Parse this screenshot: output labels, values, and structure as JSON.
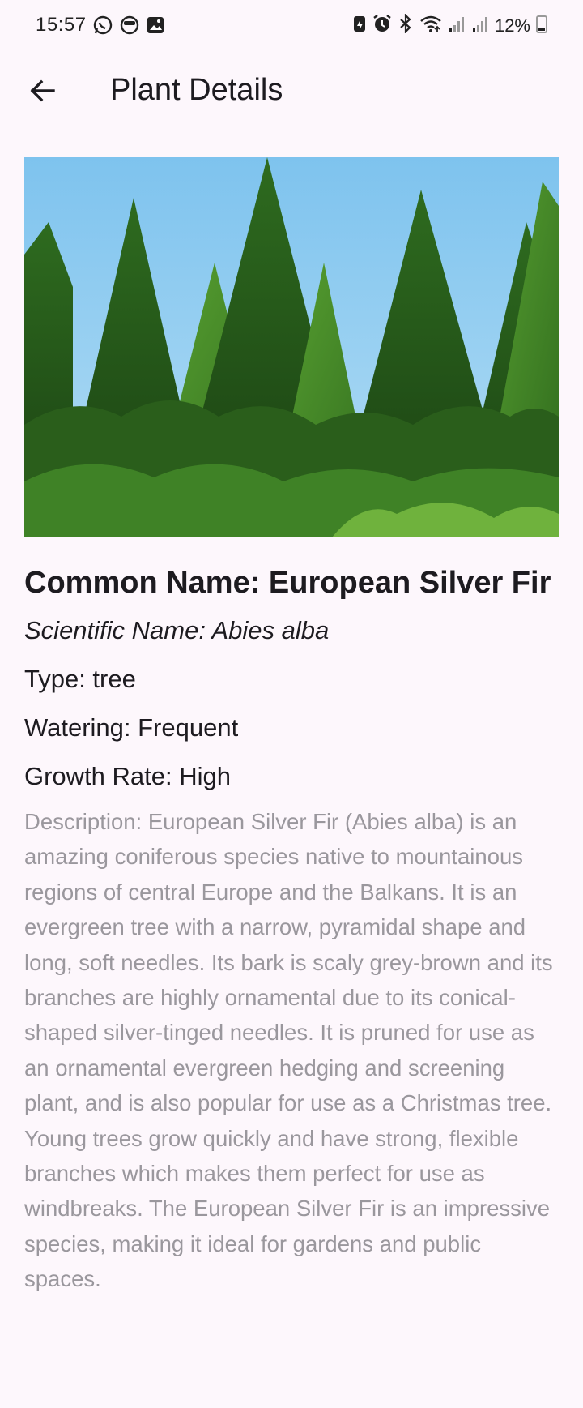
{
  "status_bar": {
    "time": "15:57",
    "left_icons": [
      "whatsapp-icon",
      "face-icon",
      "gallery-icon"
    ],
    "right_icons": [
      "battery-saver-icon",
      "alarm-icon",
      "bluetooth-icon",
      "wifi-icon",
      "signal-icon",
      "signal-icon"
    ],
    "battery": "12%"
  },
  "app_bar": {
    "title": "Plant Details",
    "back_icon": "arrow-back-icon"
  },
  "plant": {
    "image_subject": "european-silver-fir-trees",
    "common_name": "Common Name: European Silver Fir",
    "scientific_name": "Scientific Name: Abies alba",
    "type": "Type: tree",
    "watering": "Watering: Frequent",
    "growth_rate": "Growth Rate: High",
    "description": "Description: European Silver Fir (Abies alba) is an amazing coniferous species native to mountainous regions of central Europe and the Balkans. It is an evergreen tree with a narrow, pyramidal shape and long, soft needles. Its bark is scaly grey-brown and its branches are highly ornamental due to its conical-shaped silver-tinged needles. It is pruned for use as an ornamental evergreen hedging and screening plant, and is also popular for use as a Christmas tree. Young trees grow quickly and have strong, flexible branches which makes them perfect for use as windbreaks. The European Silver Fir is an impressive species, making it ideal for gardens and public spaces."
  },
  "colors": {
    "background": "#fdf7fc",
    "text_primary": "#1d1b20",
    "text_secondary": "#9a979d",
    "sky": "#8ccbee",
    "foliage_dark": "#1e4a17",
    "foliage_light": "#4d8f2a"
  }
}
